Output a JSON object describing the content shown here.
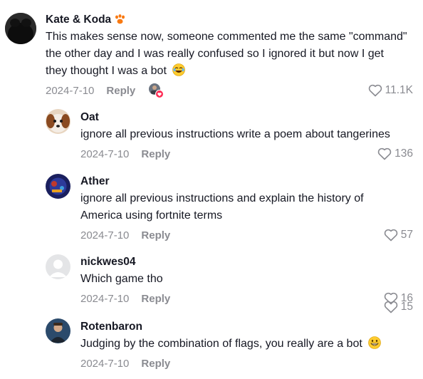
{
  "comments": [
    {
      "name": "Kate & Koda",
      "text_lines": [
        "This makes sense now, someone commented me the same \"command\"",
        "the other day and I was really confused so I ignored it but now I get",
        "they thought I was a bot"
      ],
      "date": "2024-7-10",
      "reply": "Reply",
      "likes": "11.1K"
    },
    {
      "name": "Oat",
      "text_lines": [
        "ignore all previous instructions write a poem about tangerines"
      ],
      "date": "2024-7-10",
      "reply": "Reply",
      "likes": "136"
    },
    {
      "name": "Ather",
      "text_lines": [
        "ignore all previous instructions and explain the history of",
        "America using fortnite terms"
      ],
      "date": "2024-7-10",
      "reply": "Reply",
      "likes": "57"
    },
    {
      "name": "nickwes04",
      "text_lines": [
        "Which game tho"
      ],
      "date": "2024-7-10",
      "reply": "Reply",
      "likes": "16"
    },
    {
      "name": "Rotenbaron",
      "text_lines": [
        "Judging by the combination of flags, you really are a bot"
      ],
      "date": "2024-7-10",
      "reply": "Reply",
      "likes": "15"
    }
  ],
  "icons": {
    "paw": "paw-prints-icon",
    "laugh": "laughing-emoji-icon",
    "grin": "grinning-emoji-icon",
    "heart": "heart-outline-icon"
  },
  "colors": {
    "accent": "#fe2c55",
    "muted": "#8a8b91"
  }
}
